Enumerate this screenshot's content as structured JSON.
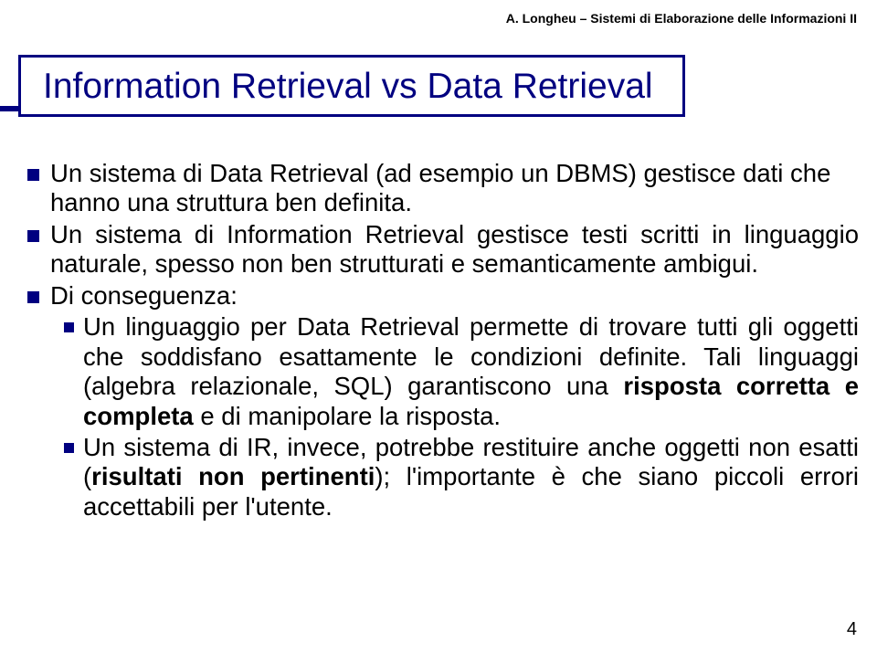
{
  "header": {
    "credit": "A. Longheu – Sistemi di Elaborazione delle Informazioni II"
  },
  "title": "Information Retrieval vs Data Retrieval",
  "bullets": {
    "b1": "Un sistema di Data Retrieval (ad esempio un DBMS) gestisce dati che hanno una struttura ben definita.",
    "b2": "Un sistema di Information Retrieval gestisce testi scritti in linguaggio naturale, spesso non ben strutturati e semanticamente ambigui.",
    "b3": "Di conseguenza:",
    "s1_a": "Un linguaggio per Data Retrieval permette di trovare tutti gli oggetti che soddisfano esattamente le condizioni definite. Tali linguaggi (algebra relazionale, SQL) garantiscono una ",
    "s1_b": "risposta corretta e completa",
    "s1_c": " e di manipolare la risposta.",
    "s2_a": "Un sistema di IR, invece, potrebbe restituire anche oggetti non esatti (",
    "s2_b": "risultati non pertinenti",
    "s2_c": "); l'importante è che siano piccoli errori accettabili per l'utente."
  },
  "page": "4"
}
